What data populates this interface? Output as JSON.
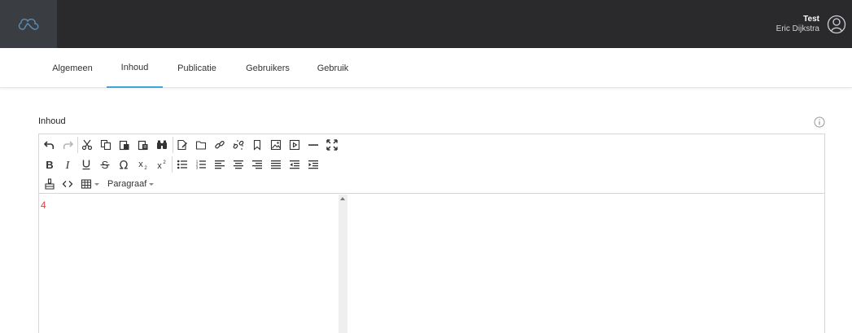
{
  "header": {
    "logo_icon": "cloud-logo-icon",
    "user_top": "Test",
    "user_name": "Eric Dijkstra",
    "avatar_icon": "user-avatar-icon",
    "background": "#2a2a2c"
  },
  "tabs": [
    {
      "label": "Algemeen",
      "active": false
    },
    {
      "label": "Inhoud",
      "active": true
    },
    {
      "label": "Publicatie",
      "active": false
    },
    {
      "label": "Gebruikers",
      "active": false
    },
    {
      "label": "Gebruik",
      "active": false
    }
  ],
  "field": {
    "label": "Inhoud",
    "info_icon": "info-icon"
  },
  "editor": {
    "toolbar_row1": [
      "undo-icon",
      "redo-icon",
      "cut-icon",
      "copy-icon",
      "paste-icon",
      "paste-text-icon",
      "find-icon",
      "new-document-icon",
      "open-folder-icon",
      "link-icon",
      "unlink-icon",
      "bookmark-icon",
      "image-icon",
      "media-icon",
      "horizontal-rule-icon",
      "fullscreen-icon"
    ],
    "toolbar_row2": [
      "bold-icon",
      "italic-icon",
      "underline-icon",
      "strikethrough-icon",
      "special-char-icon",
      "subscript-icon",
      "superscript-icon",
      "bullet-list-icon",
      "numbered-list-icon",
      "align-left-icon",
      "align-center-icon",
      "align-right-icon",
      "align-justify-icon",
      "outdent-icon",
      "indent-icon"
    ],
    "toolbar_row3": [
      "clear-format-icon",
      "code-icon",
      "table-icon"
    ],
    "format_dropdown": "Paragraaf",
    "source_value": "4",
    "accent_color": "#3aa7d6",
    "value_color": "#e0413d"
  }
}
